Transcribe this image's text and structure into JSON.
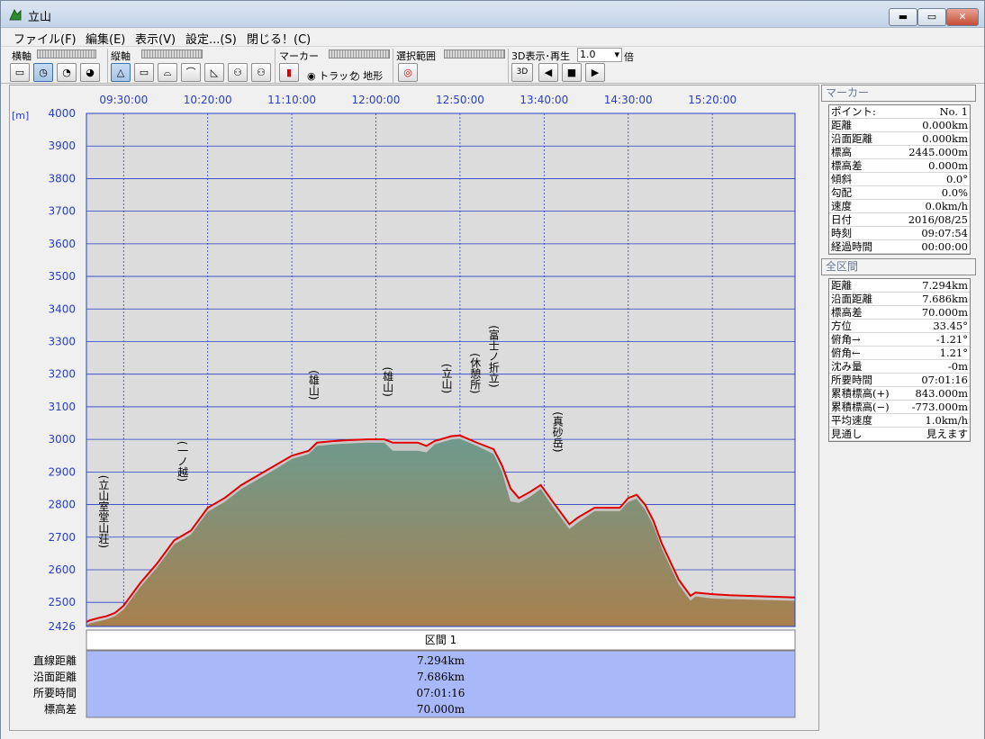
{
  "window": {
    "title": "立山",
    "min_label": "▬",
    "max_label": "▭",
    "close_label": "✕"
  },
  "menu": [
    "ファイル(F)",
    "編集(E)",
    "表示(V)",
    "設定...(S)",
    "閉じる！(C)"
  ],
  "toolbar": {
    "h_axis_label": "横軸",
    "v_axis_label": "縦軸",
    "marker_label": "マーカー",
    "track_label": "トラック",
    "terrain_label": "地形",
    "range_label": "選択範囲",
    "play3d_label": "3D表示･再生",
    "speed_value": "1.0",
    "speed_unit": "倍",
    "btn_3d_label": "3D"
  },
  "chart_data": {
    "type": "area",
    "ylabel": "[m]",
    "ylim": [
      2426,
      4000
    ],
    "yticks": [
      4000,
      3900,
      3800,
      3700,
      3600,
      3500,
      3400,
      3300,
      3200,
      3100,
      3000,
      2900,
      2800,
      2700,
      2600,
      2500,
      2426
    ],
    "xlim": [
      "09:07:54",
      "16:09:10"
    ],
    "xticks": [
      "09:30:00",
      "10:20:00",
      "11:10:00",
      "12:00:00",
      "12:50:00",
      "13:40:00",
      "14:30:00",
      "15:20:00"
    ],
    "colors": {
      "track": "#e00000",
      "grid": "#2a3ec8",
      "fill_top": "#6e9a8e",
      "fill_bottom": "#a8804d",
      "plot_bg": "#dcdcdc"
    },
    "track": {
      "x": [
        "09:07:54",
        "09:10:00",
        "09:15:00",
        "09:20:00",
        "09:25:00",
        "09:30:00",
        "09:40:00",
        "09:50:00",
        "10:00:00",
        "10:10:00",
        "10:20:00",
        "10:30:00",
        "10:40:00",
        "10:50:00",
        "11:00:00",
        "11:10:00",
        "11:20:00",
        "11:25:00",
        "11:35:00",
        "11:45:00",
        "11:55:00",
        "12:05:00",
        "12:10:00",
        "12:25:00",
        "12:30:00",
        "12:35:00",
        "12:45:00",
        "12:50:00",
        "13:00:00",
        "13:10:00",
        "13:15:00",
        "13:20:00",
        "13:25:00",
        "13:32:00",
        "13:38:00",
        "13:45:00",
        "13:55:00",
        "14:00:00",
        "14:10:00",
        "14:20:00",
        "14:25:00",
        "14:30:00",
        "14:35:00",
        "14:40:00",
        "14:45:00",
        "14:50:00",
        "15:00:00",
        "15:07:00",
        "15:10:00",
        "15:20:00",
        "15:30:00",
        "16:09:10"
      ],
      "y": [
        2440,
        2445,
        2452,
        2458,
        2468,
        2490,
        2560,
        2620,
        2690,
        2720,
        2790,
        2820,
        2860,
        2890,
        2920,
        2950,
        2965,
        2990,
        2995,
        2998,
        3000,
        3000,
        2990,
        2990,
        2980,
        2995,
        3010,
        3012,
        2990,
        2970,
        2920,
        2850,
        2820,
        2840,
        2860,
        2810,
        2740,
        2760,
        2790,
        2790,
        2790,
        2820,
        2830,
        2800,
        2750,
        2680,
        2570,
        2520,
        2530,
        2525,
        2522,
        2515
      ]
    },
    "terrain": {
      "x": [
        "09:07:54",
        "09:10:00",
        "09:15:00",
        "09:20:00",
        "09:25:00",
        "09:30:00",
        "09:40:00",
        "09:50:00",
        "10:00:00",
        "10:10:00",
        "10:20:00",
        "10:30:00",
        "10:40:00",
        "10:50:00",
        "11:00:00",
        "11:10:00",
        "11:20:00",
        "11:25:00",
        "11:35:00",
        "11:45:00",
        "11:55:00",
        "12:05:00",
        "12:10:00",
        "12:25:00",
        "12:30:00",
        "12:35:00",
        "12:45:00",
        "12:50:00",
        "13:00:00",
        "13:10:00",
        "13:15:00",
        "13:20:00",
        "13:25:00",
        "13:32:00",
        "13:38:00",
        "13:45:00",
        "13:55:00",
        "14:00:00",
        "14:10:00",
        "14:20:00",
        "14:25:00",
        "14:30:00",
        "14:35:00",
        "14:40:00",
        "14:45:00",
        "14:50:00",
        "15:00:00",
        "15:07:00",
        "15:10:00",
        "15:20:00",
        "15:30:00",
        "16:09:10"
      ],
      "y": [
        2430,
        2436,
        2442,
        2448,
        2458,
        2478,
        2548,
        2608,
        2678,
        2708,
        2778,
        2808,
        2848,
        2878,
        2908,
        2940,
        2955,
        2980,
        2985,
        2988,
        2990,
        2990,
        2965,
        2965,
        2960,
        2985,
        3000,
        3002,
        2980,
        2955,
        2900,
        2810,
        2805,
        2825,
        2848,
        2795,
        2725,
        2745,
        2780,
        2780,
        2780,
        2808,
        2818,
        2785,
        2735,
        2665,
        2555,
        2505,
        2518,
        2512,
        2510,
        2505
      ]
    },
    "annotations": [
      {
        "label": "(立山室堂山荘)",
        "x": "09:18:00"
      },
      {
        "label": "(一ノ越)",
        "x": "10:05:00"
      },
      {
        "label": "(雄山)",
        "x": "11:23:00"
      },
      {
        "label": "(雄山)",
        "x": "12:07:00"
      },
      {
        "label": "(立山)",
        "x": "12:42:00"
      },
      {
        "label": "(休憩所)",
        "x": "12:59:00"
      },
      {
        "label": "(富士ノ折立)",
        "x": "13:10:00"
      },
      {
        "label": "(真砂岳)",
        "x": "13:48:00"
      }
    ],
    "section_table": {
      "header": "区間 1",
      "rows": [
        {
          "label": "直線距離",
          "value": "7.294km"
        },
        {
          "label": "沿面距離",
          "value": "7.686km"
        },
        {
          "label": "所要時間",
          "value": "07:01:16"
        },
        {
          "label": "標高差",
          "value": "70.000m"
        }
      ]
    }
  },
  "marker_panel": {
    "title": "マーカー",
    "rows": [
      {
        "label": "ポイント:",
        "value": "No. 1"
      },
      {
        "label": "距離",
        "value": "0.000km"
      },
      {
        "label": "沿面距離",
        "value": "0.000km"
      },
      {
        "label": "標高",
        "value": "2445.000m"
      },
      {
        "label": "標高差",
        "value": "0.000m"
      },
      {
        "label": "傾斜",
        "value": "0.0°"
      },
      {
        "label": "勾配",
        "value": "0.0%"
      },
      {
        "label": "速度",
        "value": "0.0km/h"
      },
      {
        "label": "日付",
        "value": "2016/08/25"
      },
      {
        "label": "時刻",
        "value": "09:07:54"
      },
      {
        "label": "経過時間",
        "value": "00:00:00"
      }
    ]
  },
  "total_panel": {
    "title": "全区間",
    "rows": [
      {
        "label": "距離",
        "value": "7.294km"
      },
      {
        "label": "沿面距離",
        "value": "7.686km"
      },
      {
        "label": "標高差",
        "value": "70.000m"
      },
      {
        "label": "方位",
        "value": "33.45°"
      },
      {
        "label": "俯角→",
        "value": "-1.21°"
      },
      {
        "label": "俯角←",
        "value": "1.21°"
      },
      {
        "label": "沈み量",
        "value": "-0m"
      },
      {
        "label": "所要時間",
        "value": "07:01:16"
      },
      {
        "label": "累積標高(+)",
        "value": "843.000m"
      },
      {
        "label": "累積標高(−)",
        "value": "-773.000m"
      },
      {
        "label": "平均速度",
        "value": "1.0km/h"
      },
      {
        "label": "見通し",
        "value": "見えます"
      }
    ]
  }
}
